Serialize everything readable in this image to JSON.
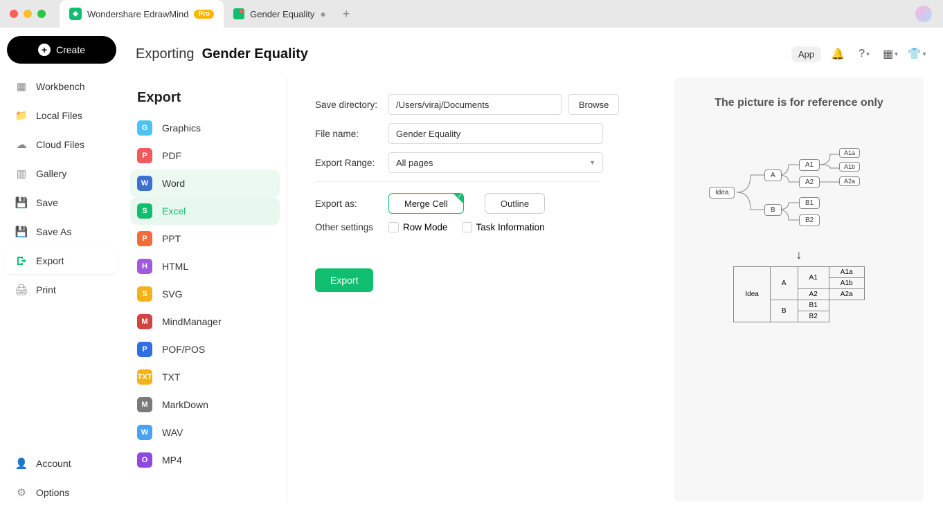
{
  "titlebar": {
    "app_name": "Wondershare EdrawMind",
    "pro_badge": "Pro",
    "doc_tab": "Gender Equality"
  },
  "sidebar": {
    "create": "Create",
    "items": [
      "Workbench",
      "Local Files",
      "Cloud Files",
      "Gallery",
      "Save",
      "Save As",
      "Export",
      "Print"
    ],
    "footer": [
      "Account",
      "Options"
    ]
  },
  "header": {
    "prefix": "Exporting",
    "doc": "Gender Equality",
    "app_pill": "App"
  },
  "export_formats": [
    "Graphics",
    "PDF",
    "Word",
    "Excel",
    "PPT",
    "HTML",
    "SVG",
    "MindManager",
    "POF/POS",
    "TXT",
    "MarkDown",
    "WAV",
    "MP4"
  ],
  "export_panel_title": "Export",
  "format_icons": {
    "colors": [
      "#4fc3f7",
      "#f05a5a",
      "#3b6fd0",
      "#0fbf6f",
      "#f36b3d",
      "#a05ae0",
      "#f2b21a",
      "#d04444",
      "#2f6fe0",
      "#f2b21a",
      "#7a7a7a",
      "#4aa3f0",
      "#8e4ae0"
    ],
    "letters": [
      "G",
      "P",
      "W",
      "S",
      "P",
      "H",
      "S",
      "M",
      "P",
      "TXT",
      "M",
      "W",
      "O"
    ]
  },
  "form": {
    "save_dir_label": "Save directory:",
    "save_dir": "/Users/viraj/Documents",
    "browse": "Browse",
    "file_name_label": "File name:",
    "file_name": "Gender Equality",
    "range_label": "Export Range:",
    "range_value": "All pages",
    "export_as_label": "Export as:",
    "merge_cell": "Merge Cell",
    "outline": "Outline",
    "other_label": "Other settings",
    "row_mode": "Row Mode",
    "task_info": "Task Information",
    "export_btn": "Export"
  },
  "preview": {
    "caption": "The picture is for reference only",
    "nodes": {
      "root": "Idea",
      "a": "A",
      "b": "B",
      "a1": "A1",
      "a2": "A2",
      "b1": "B1",
      "b2": "B2",
      "a1a": "A1a",
      "a1b": "A1b",
      "a2a": "A2a"
    }
  }
}
